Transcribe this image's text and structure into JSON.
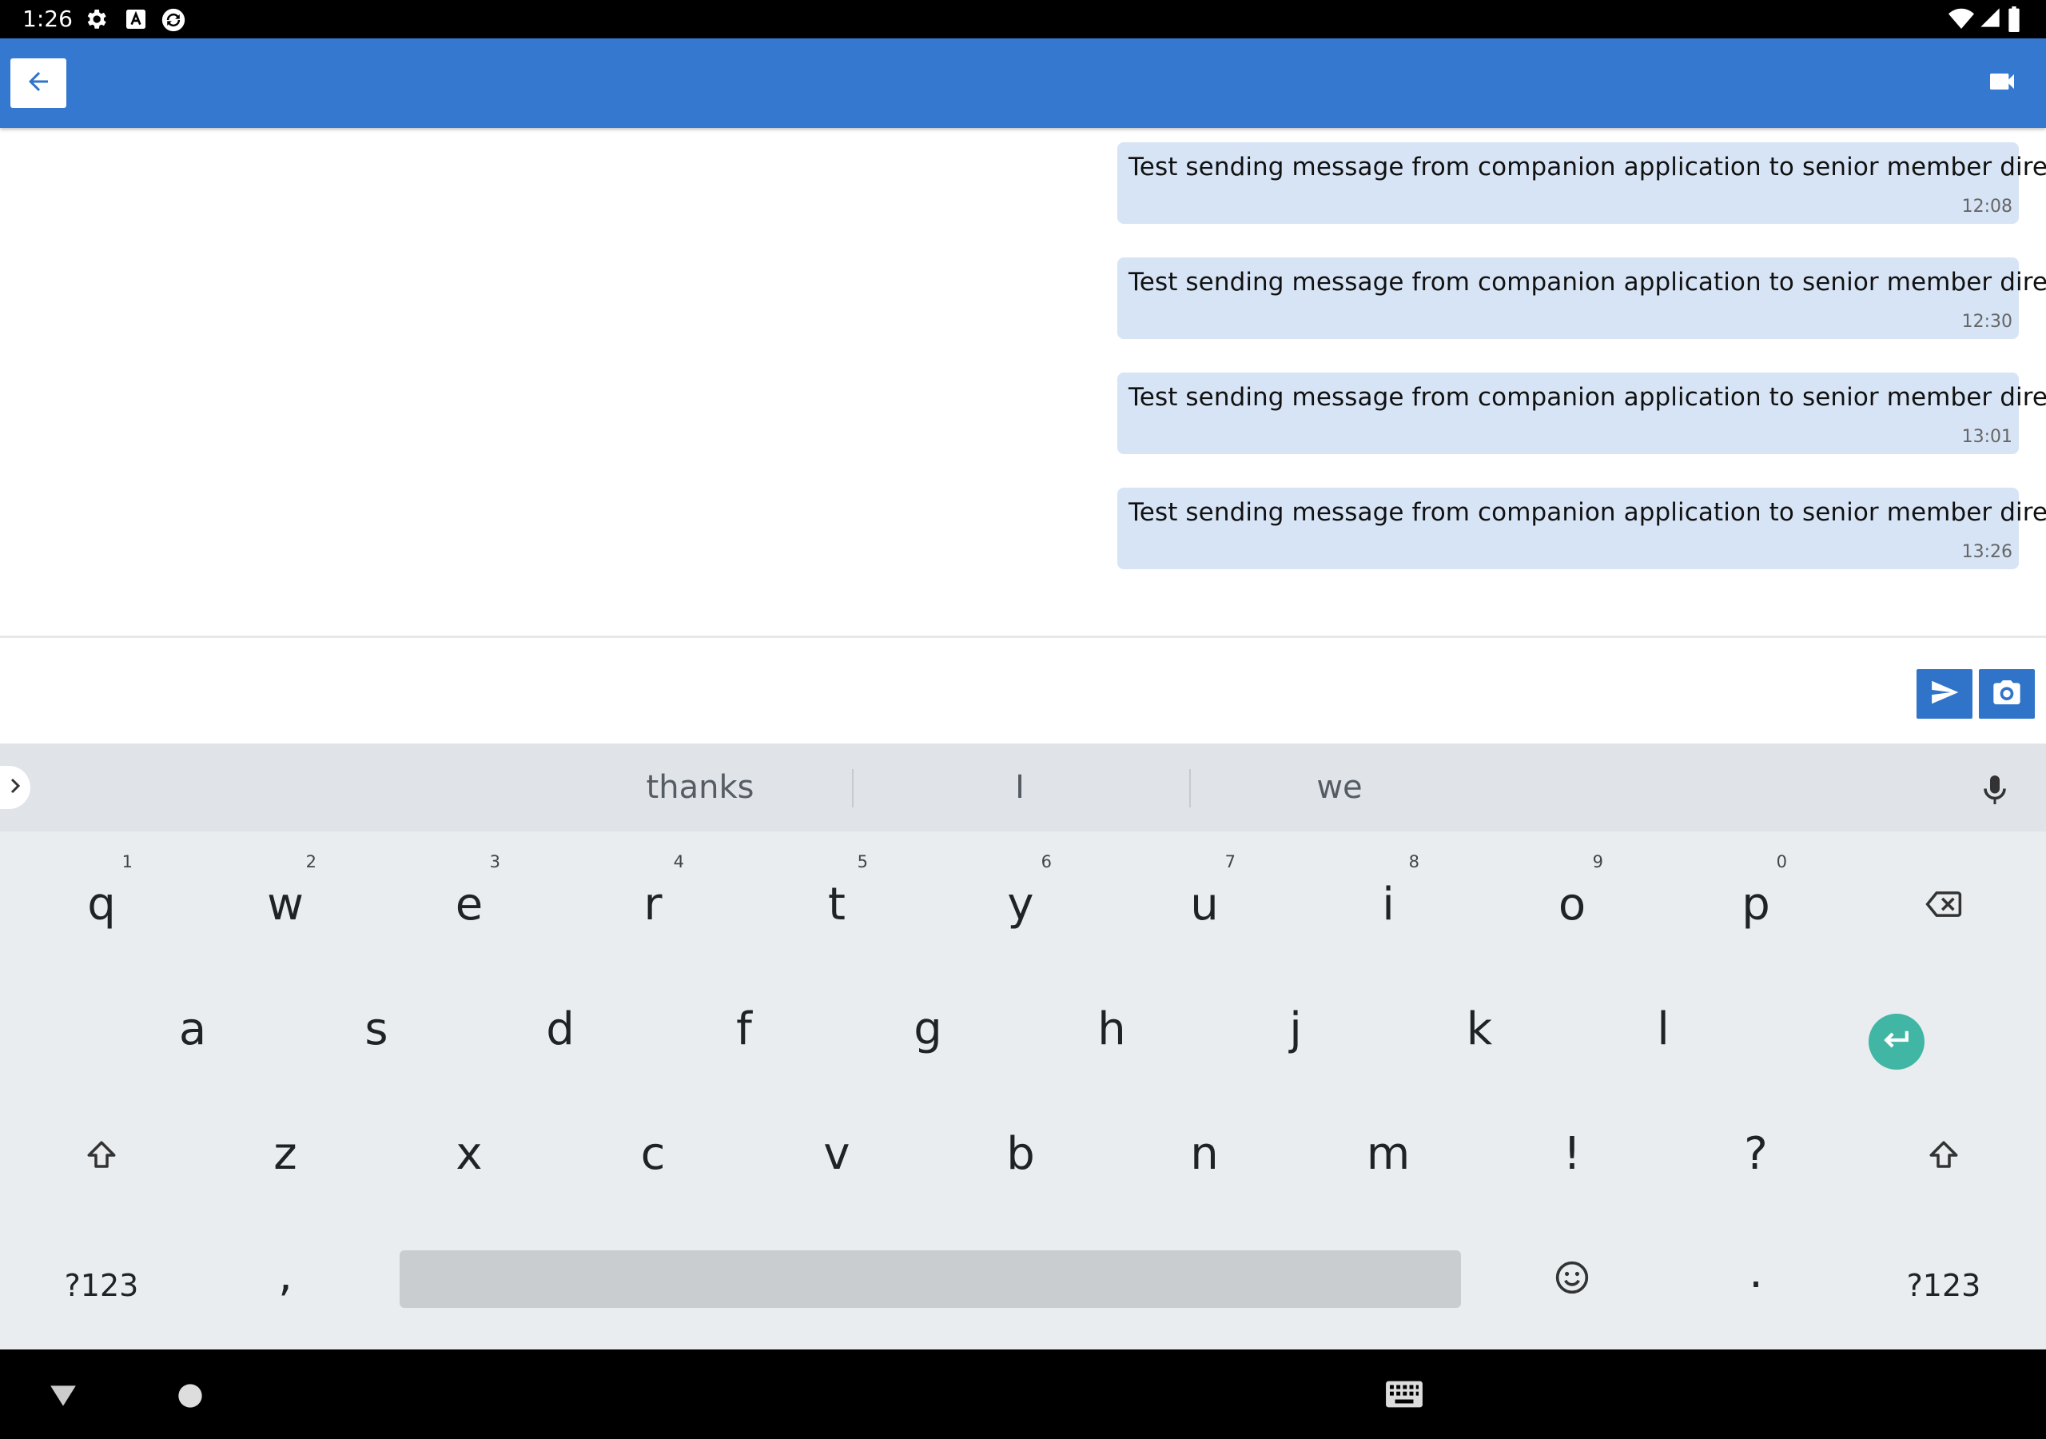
{
  "status_bar": {
    "time": "1:26"
  },
  "messages": [
    {
      "text": "Test sending message from companion application to senior member directly",
      "time": "12:08"
    },
    {
      "text": "Test sending message from companion application to senior member directly",
      "time": "12:30"
    },
    {
      "text": "Test sending message from companion application to senior member directly",
      "time": "13:01"
    },
    {
      "text": "Test sending message from companion application to senior member directly",
      "time": "13:26"
    }
  ],
  "composer": {
    "input_value": ""
  },
  "keyboard": {
    "suggestions": [
      "thanks",
      "I",
      "we"
    ],
    "row1": [
      {
        "key": "q",
        "hint": "1"
      },
      {
        "key": "w",
        "hint": "2"
      },
      {
        "key": "e",
        "hint": "3"
      },
      {
        "key": "r",
        "hint": "4"
      },
      {
        "key": "t",
        "hint": "5"
      },
      {
        "key": "y",
        "hint": "6"
      },
      {
        "key": "u",
        "hint": "7"
      },
      {
        "key": "i",
        "hint": "8"
      },
      {
        "key": "o",
        "hint": "9"
      },
      {
        "key": "p",
        "hint": "0"
      }
    ],
    "row2": [
      "a",
      "s",
      "d",
      "f",
      "g",
      "h",
      "j",
      "k",
      "l"
    ],
    "row3": [
      "z",
      "x",
      "c",
      "v",
      "b",
      "n",
      "m",
      "!",
      "?"
    ],
    "symbols_left": "?123",
    "comma": ",",
    "period": ".",
    "symbols_right": "?123"
  },
  "icons": {
    "status": [
      "gear-icon",
      "a-badge-icon",
      "sync-icon",
      "wifi-icon",
      "signal-icon",
      "battery-icon"
    ],
    "app_bar": [
      "arrow-left-icon",
      "video-camera-icon"
    ],
    "composer": [
      "send-icon",
      "camera-icon"
    ],
    "keyboard": [
      "chevron-right-icon",
      "mic-icon",
      "backspace-icon",
      "enter-icon",
      "shift-icon",
      "emoji-icon"
    ],
    "nav": [
      "back-triangle-icon",
      "home-circle-icon",
      "keyboard-icon"
    ]
  },
  "colors": {
    "app_bar": "#3478d0",
    "bubble": "#d7e4f5",
    "action_button": "#2f74c9",
    "enter_key": "#41b6a4",
    "keyboard_bg": "#e9edf0"
  }
}
